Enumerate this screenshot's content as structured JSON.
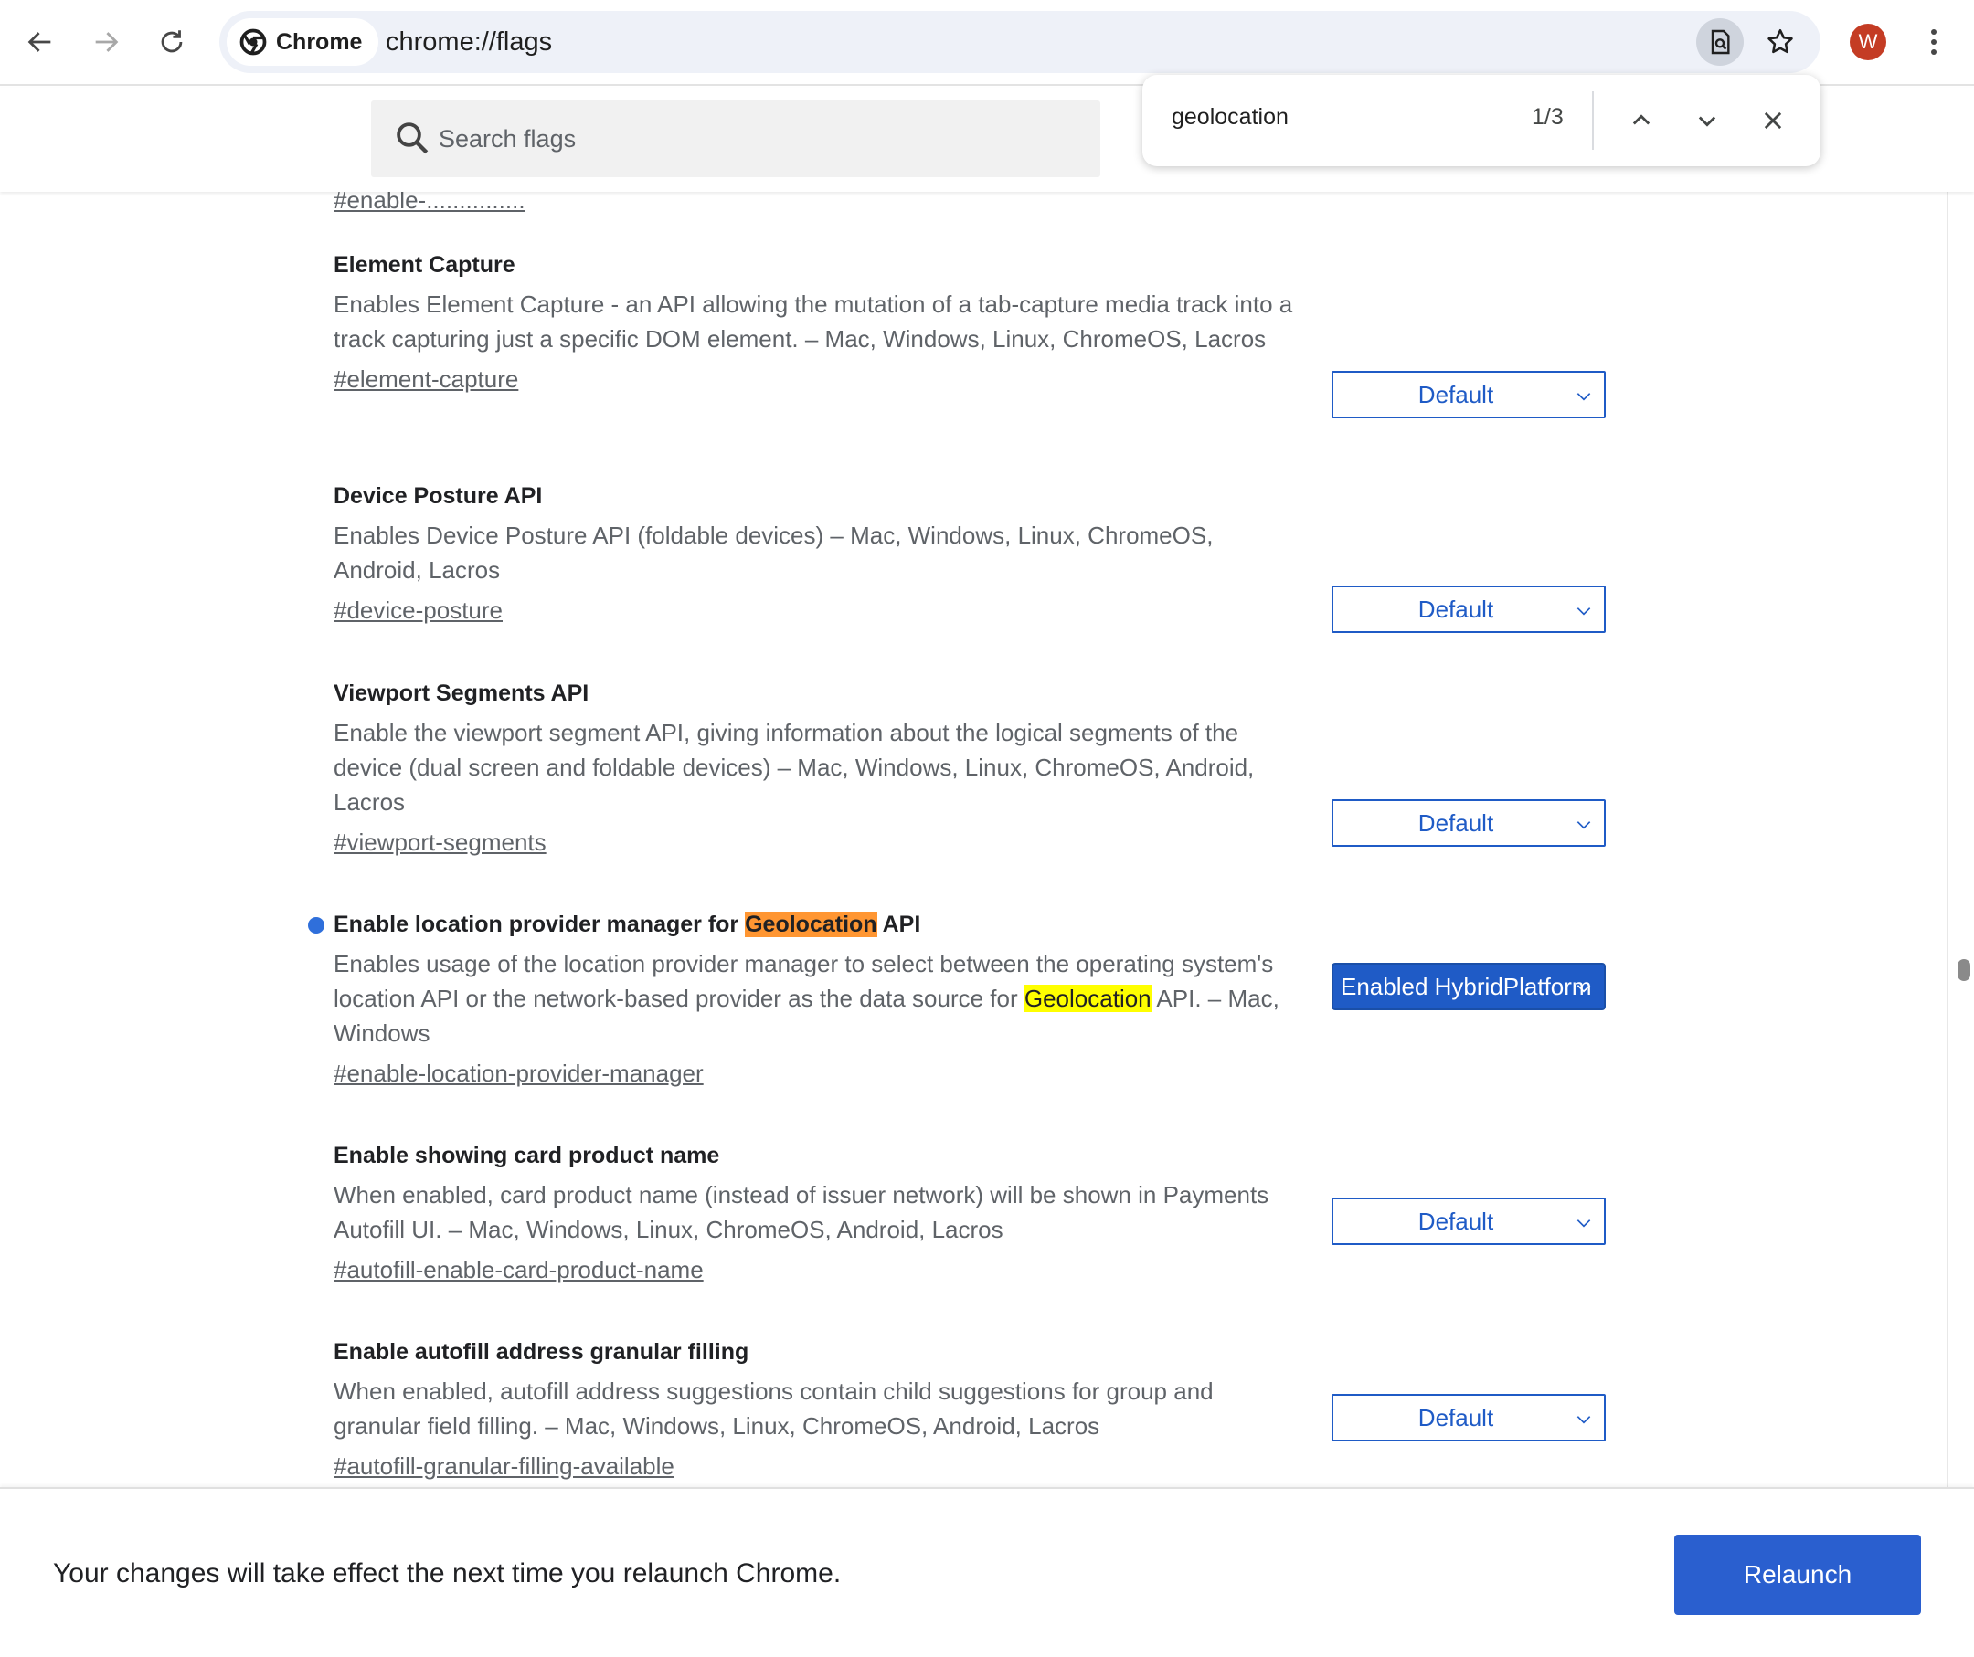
{
  "browser": {
    "chip_label": "Chrome",
    "url": "chrome://flags",
    "avatar_letter": "W"
  },
  "search": {
    "placeholder": "Search flags"
  },
  "find_bar": {
    "query": "geolocation",
    "count": "1/3"
  },
  "cut_off_link": "#enable-...............",
  "flags": [
    {
      "title": "Element Capture",
      "description": "Enables Element Capture - an API allowing the mutation of a tab-capture media track into a track capturing just a specific DOM element. – Mac, Windows, Linux, ChromeOS, Lacros",
      "link": "#element-capture",
      "value": "Default"
    },
    {
      "title": "Device Posture API",
      "description": "Enables Device Posture API (foldable devices) – Mac, Windows, Linux, ChromeOS, Android, Lacros",
      "link": "#device-posture",
      "value": "Default"
    },
    {
      "title": "Viewport Segments API",
      "description": "Enable the viewport segment API, giving information about the logical segments of the device (dual screen and foldable devices) – Mac, Windows, Linux, ChromeOS, Android, Lacros",
      "link": "#viewport-segments",
      "value": "Default"
    },
    {
      "title_before": "Enable location provider manager for ",
      "title_highlight": "Geolocation",
      "title_after": " API",
      "description_before": "Enables usage of the location provider manager to select between the operating system's location API or the network-based provider as the data source for ",
      "description_highlight": "Geolocation",
      "description_after": " API. – Mac, Windows",
      "link": "#enable-location-provider-manager",
      "value": "Enabled HybridPlatform"
    },
    {
      "title": "Enable showing card product name",
      "description": "When enabled, card product name (instead of issuer network) will be shown in Payments Autofill UI. – Mac, Windows, Linux, ChromeOS, Android, Lacros",
      "link": "#autofill-enable-card-product-name",
      "value": "Default"
    },
    {
      "title": "Enable autofill address granular filling",
      "description": "When enabled, autofill address suggestions contain child suggestions for group and granular field filling. – Mac, Windows, Linux, ChromeOS, Android, Lacros",
      "link": "#autofill-granular-filling-available",
      "value": "Default"
    }
  ],
  "relaunch": {
    "message": "Your changes will take effect the next time you relaunch Chrome.",
    "button": "Relaunch"
  },
  "colors": {
    "accent": "#1f5bc6",
    "active_match": "#ff9632",
    "match": "#ffff00",
    "modified_dot": "#2f6fdb"
  }
}
